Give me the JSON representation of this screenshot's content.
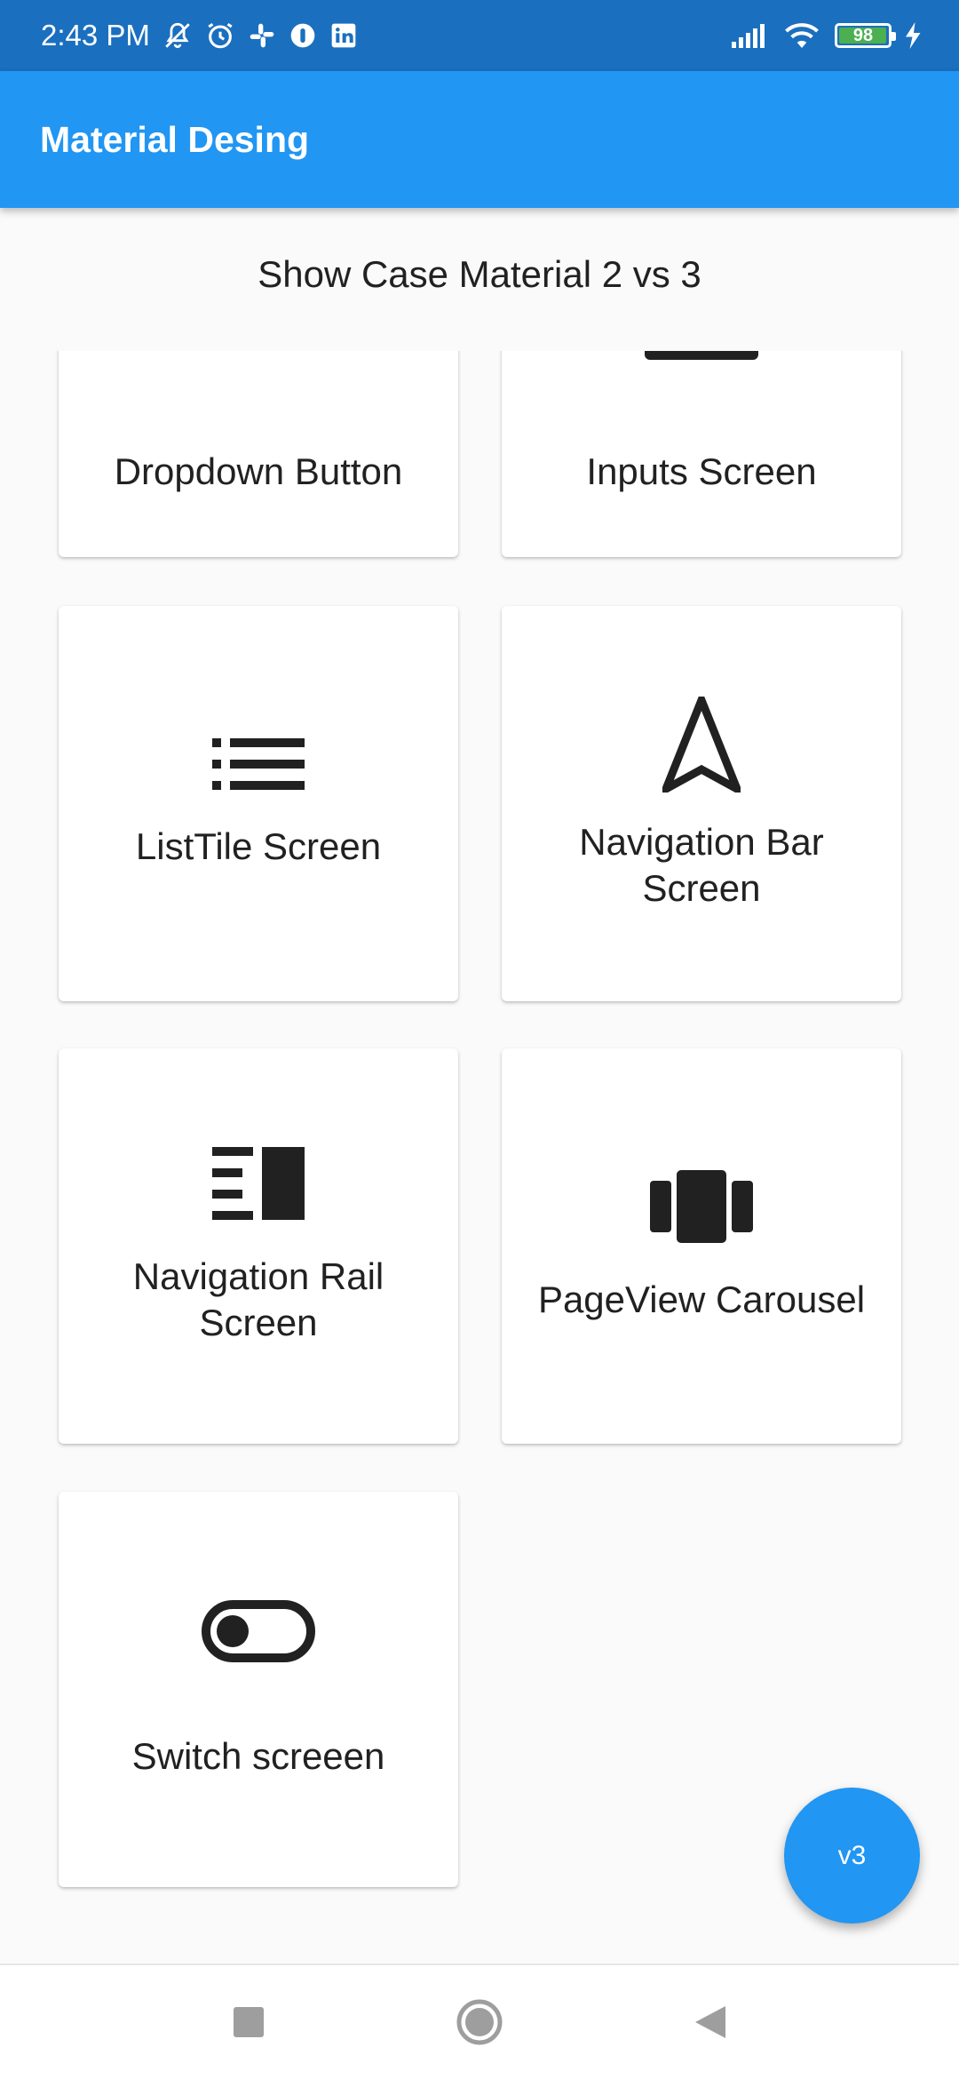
{
  "status_bar": {
    "time": "2:43 PM",
    "battery_level": "98",
    "battery_fraction": 0.98,
    "icons_left": [
      "mute-notification-icon",
      "alarm-icon",
      "slack-icon",
      "app-icon",
      "linkedin-icon"
    ],
    "icons_right": [
      "signal-icon",
      "wifi-icon",
      "battery-icon",
      "charging-icon"
    ]
  },
  "app_bar": {
    "title": "Material Desing"
  },
  "subtitle": "Show Case Material 2 vs 3",
  "cards": [
    {
      "label": "Dropdown Button",
      "icon": "none"
    },
    {
      "label": "Inputs Screen",
      "icon": "input-icon"
    },
    {
      "label": "ListTile Screen",
      "icon": "list-icon"
    },
    {
      "label": "Navigation Bar Screen",
      "icon": "navigation-arrow-icon"
    },
    {
      "label": "Navigation Rail Screen",
      "icon": "navigation-rail-icon"
    },
    {
      "label": "PageView Carousel",
      "icon": "carousel-icon"
    },
    {
      "label": "Switch screeen",
      "icon": "toggle-icon"
    }
  ],
  "fab": {
    "label": "v3"
  },
  "nav_bar": {
    "buttons": [
      "recents-button",
      "home-button",
      "back-button"
    ]
  },
  "colors": {
    "status_bar": "#1a6fbf",
    "primary": "#2196f3",
    "background": "#fafafa",
    "card": "#ffffff",
    "text": "#212121",
    "battery_green": "#4caf50"
  }
}
